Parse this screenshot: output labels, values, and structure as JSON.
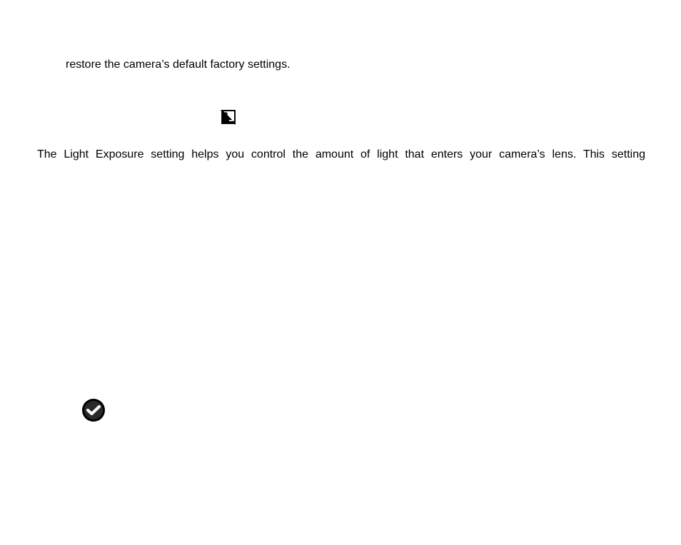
{
  "content": {
    "line1": "restore the camera’s default factory settings.",
    "line2": "The Light Exposure setting helps you control the amount of light that enters your camera’s lens. This setting"
  },
  "icons": {
    "exposure": "exposure-icon",
    "check": "check-circle-icon"
  }
}
